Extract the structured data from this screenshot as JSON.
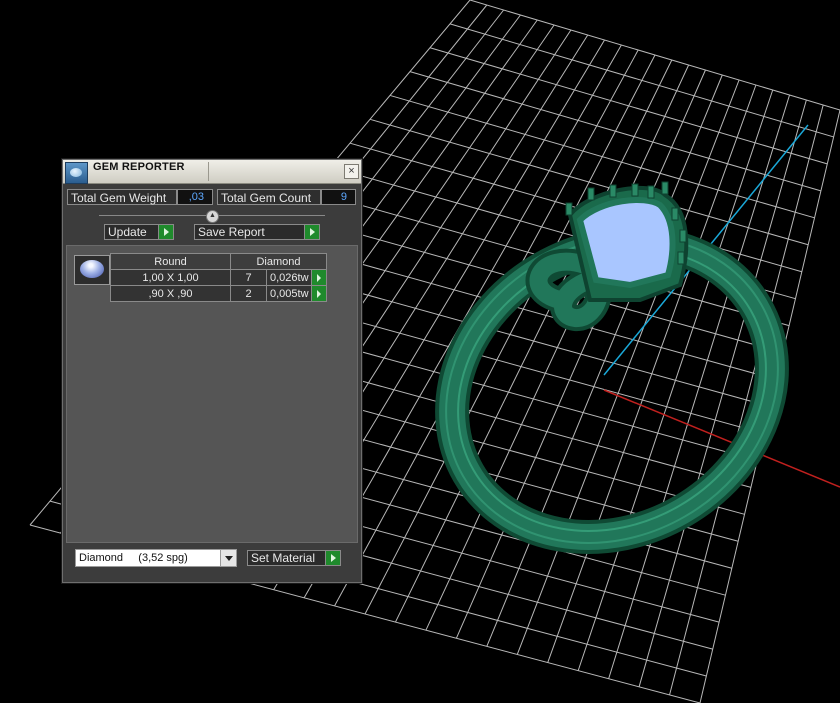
{
  "window": {
    "title": "GEM REPORTER",
    "close_label": "×"
  },
  "summary": {
    "total_weight_label": "Total Gem Weight",
    "total_weight_value": ",03",
    "total_count_label": "Total Gem Count",
    "total_count_value": "9"
  },
  "toolbar": {
    "update_label": "Update",
    "save_report_label": "Save Report"
  },
  "gem_table": {
    "headers": [
      "Round",
      "Diamond"
    ],
    "rows": [
      {
        "size": "1,00 X 1,00",
        "count": "7",
        "weight": "0,026tw"
      },
      {
        "size": ",90 X ,90",
        "count": "2",
        "weight": "0,005tw"
      }
    ]
  },
  "material": {
    "selected": "Diamond     (3,52 spg)",
    "set_label": "Set Material"
  },
  "colors": {
    "accent_green": "#1f8a2c",
    "value_blue": "#5da8ff",
    "model_green": "#1f6e4f"
  },
  "icons": [
    "gem-reporter-app-icon",
    "close-icon",
    "collapse-arrow-icon",
    "play-arrow-icon",
    "gem-thumbnail-icon",
    "dropdown-arrow-icon"
  ]
}
